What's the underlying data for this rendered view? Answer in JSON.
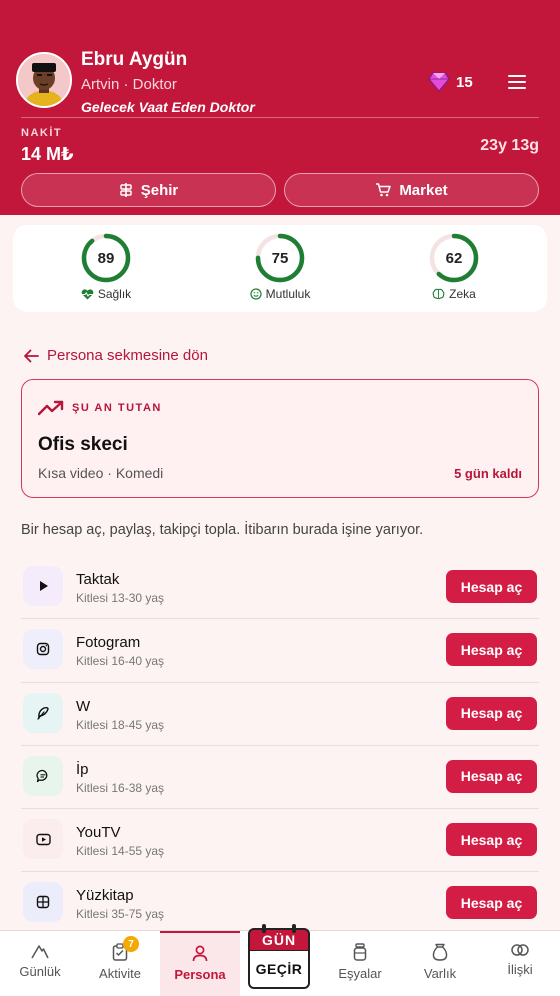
{
  "profile": {
    "name": "Ebru Aygün",
    "location_job": "Artvin · Doktor",
    "motto": "Gelecek Vaat Eden Doktor",
    "gems": "15",
    "cash_label": "NAKİT",
    "cash_value": "14 M₺",
    "age": "23y 13g"
  },
  "header_buttons": {
    "city": "Şehir",
    "market": "Market"
  },
  "stats": [
    {
      "label": "Sağlık",
      "value": 89,
      "color": "#1e7e34",
      "icon": "heart-pulse-icon"
    },
    {
      "label": "Mutluluk",
      "value": 75,
      "color": "#1e7e34",
      "icon": "smile-icon"
    },
    {
      "label": "Zeka",
      "value": 62,
      "color": "#1e7e34",
      "icon": "brain-icon"
    }
  ],
  "back_link": "Persona sekmesine dön",
  "trending": {
    "heading": "ŞU AN TUTAN",
    "title": "Ofis skeci",
    "subtitle": "Kısa video · Komedi",
    "days_left": "5 gün kaldı"
  },
  "intro": "Bir hesap aç, paylaş, takipçi topla. İtibarın burada işine yarıyor.",
  "platforms": [
    {
      "name": "Taktak",
      "audience": "Kitlesi 13-30 yaş",
      "button": "Hesap aç",
      "icon": "play-icon",
      "icon_bg": "#f4ebfb"
    },
    {
      "name": "Fotogram",
      "audience": "Kitlesi 16-40 yaş",
      "button": "Hesap aç",
      "icon": "camera-icon",
      "icon_bg": "#efeefb"
    },
    {
      "name": "W",
      "audience": "Kitlesi 18-45 yaş",
      "button": "Hesap aç",
      "icon": "feather-icon",
      "icon_bg": "#e6f4f3"
    },
    {
      "name": "İp",
      "audience": "Kitlesi 16-38 yaş",
      "button": "Hesap aç",
      "icon": "chat-icon",
      "icon_bg": "#e8f5ec"
    },
    {
      "name": "YouTV",
      "audience": "Kitlesi 14-55 yaş",
      "button": "Hesap aç",
      "icon": "video-icon",
      "icon_bg": "#fbecee"
    },
    {
      "name": "Yüzkitap",
      "audience": "Kitlesi 35-75 yaş",
      "button": "Hesap aç",
      "icon": "grid-icon",
      "icon_bg": "#ecedfb"
    }
  ],
  "nav": {
    "items": [
      {
        "label": "Günlük",
        "icon": "mountain-icon"
      },
      {
        "label": "Aktivite",
        "icon": "clipboard-icon",
        "badge": "7"
      },
      {
        "label": "Persona",
        "icon": "person-icon"
      },
      {
        "label": "Eşyalar",
        "icon": "jar-icon"
      },
      {
        "label": "Varlık",
        "icon": "bag-icon"
      },
      {
        "label": "İlişki",
        "icon": "rings-icon"
      }
    ],
    "gun_top": "GÜN",
    "gun_bottom": "GEÇİR"
  },
  "colors": {
    "brand": "#c2163b",
    "button": "#d41d45",
    "ring_track": "#f4e3e3",
    "ring": "#1e7e34"
  }
}
